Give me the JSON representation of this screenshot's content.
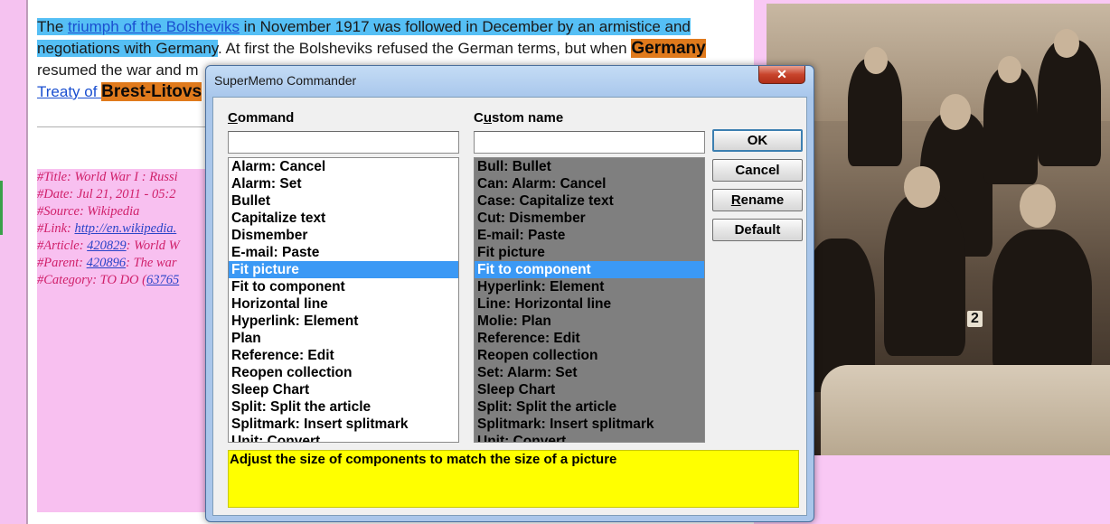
{
  "article": {
    "line1_a": "The ",
    "line1_link": "triumph of the Bolsheviks",
    "line1_b": " in November 1917 was followed in December by an armistice and",
    "line2_a": "negotiations with Germany",
    "line2_b": ". At first the Bolsheviks refused the German terms, but when ",
    "line2_hl": "Germany",
    "line3_a": "resumed the war and m",
    "line4_link": "Treaty of ",
    "line4_hl": "Brest-Litovs"
  },
  "meta": {
    "title": "#Title: World War I : Russi",
    "date": "#Date: Jul 21, 2011 - 05:2",
    "source": "#Source: Wikipedia",
    "link_label": "#Link: ",
    "link_value": "http://en.wikipedia.",
    "article_label": "#Article: ",
    "article_id": "420829",
    "article_rest": ": World W",
    "parent_label": "#Parent: ",
    "parent_id": "420896",
    "parent_rest": ": The war",
    "category_label": "#Category: TO DO (",
    "category_id": "63765"
  },
  "photo": {
    "badge": "2"
  },
  "dialog": {
    "title": "SuperMemo Commander",
    "close_glyph": "✕",
    "command_label_first": "C",
    "command_label_rest": "ommand",
    "custom_label_first": "C",
    "custom_label_u": "u",
    "custom_label_rest": "stom name",
    "command_input": "",
    "custom_input": "",
    "commands": [
      "Alarm: Cancel",
      "Alarm: Set",
      "Bullet",
      "Capitalize text",
      "Dismember",
      "E-mail: Paste",
      "Fit picture",
      "Fit to component",
      "Horizontal line",
      "Hyperlink: Element",
      "Plan",
      "Reference: Edit",
      "Reopen collection",
      "Sleep Chart",
      "Split: Split the article",
      "Splitmark: Insert splitmark",
      "Unit: Convert"
    ],
    "custom_names": [
      "Bull: Bullet",
      "Can: Alarm: Cancel",
      "Case: Capitalize text",
      "Cut: Dismember",
      "E-mail: Paste",
      "Fit picture",
      "Fit to component",
      "Hyperlink: Element",
      "Line: Horizontal line",
      "Molie: Plan",
      "Reference: Edit",
      "Reopen collection",
      "Set: Alarm: Set",
      "Sleep Chart",
      "Split: Split the article",
      "Splitmark: Insert splitmark",
      "Unit: Convert"
    ],
    "selected_command": "Fit picture",
    "selected_custom": "Fit to component",
    "ok_label": "OK",
    "cancel_label": "Cancel",
    "rename_first": "R",
    "rename_rest": "ename",
    "default_label": "Default",
    "hint": "Adjust the size of components to match the size of a picture"
  },
  "colors": {
    "selection": "#3b99f5",
    "hint_background": "#ffff00",
    "custom_list_background": "#7f7f7f",
    "highlight_orange": "#e07a1c",
    "highlight_blue": "#55bff5",
    "meta_background": "#f8c0f0",
    "meta_text": "#d0206a"
  }
}
